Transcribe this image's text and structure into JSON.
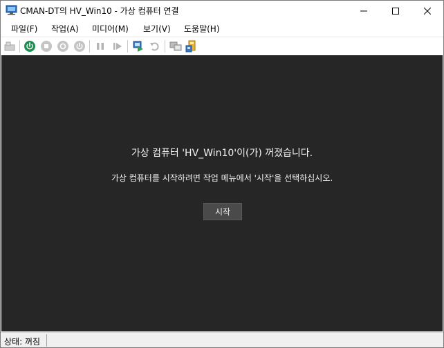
{
  "window": {
    "title": "CMAN-DT의 HV_Win10 - 가상 컴퓨터 연결",
    "icon": "vm-connection-icon"
  },
  "menu": {
    "items": [
      {
        "label": "파일(F)"
      },
      {
        "label": "작업(A)"
      },
      {
        "label": "미디어(M)"
      },
      {
        "label": "보기(V)"
      },
      {
        "label": "도움말(H)"
      }
    ]
  },
  "toolbar": {
    "buttons": [
      "ctrl-alt-del-icon",
      "start-icon",
      "turn-off-icon",
      "shutdown-icon",
      "power-icon",
      "pause-icon",
      "resume-icon",
      "checkpoint-icon",
      "revert-icon",
      "enhanced-session-icon",
      "share-icon"
    ],
    "colors": {
      "start_green": "#1e8f4e",
      "disabled_gray": "#b4b4b4"
    }
  },
  "display": {
    "background": "#262626",
    "message_title": "가상 컴퓨터 'HV_Win10'이(가) 꺼졌습니다.",
    "message_sub": "가상 컴퓨터를 시작하려면 작업 메뉴에서 '시작'을 선택하십시오.",
    "start_button_label": "시작"
  },
  "status": {
    "text": "상태: 꺼짐"
  }
}
